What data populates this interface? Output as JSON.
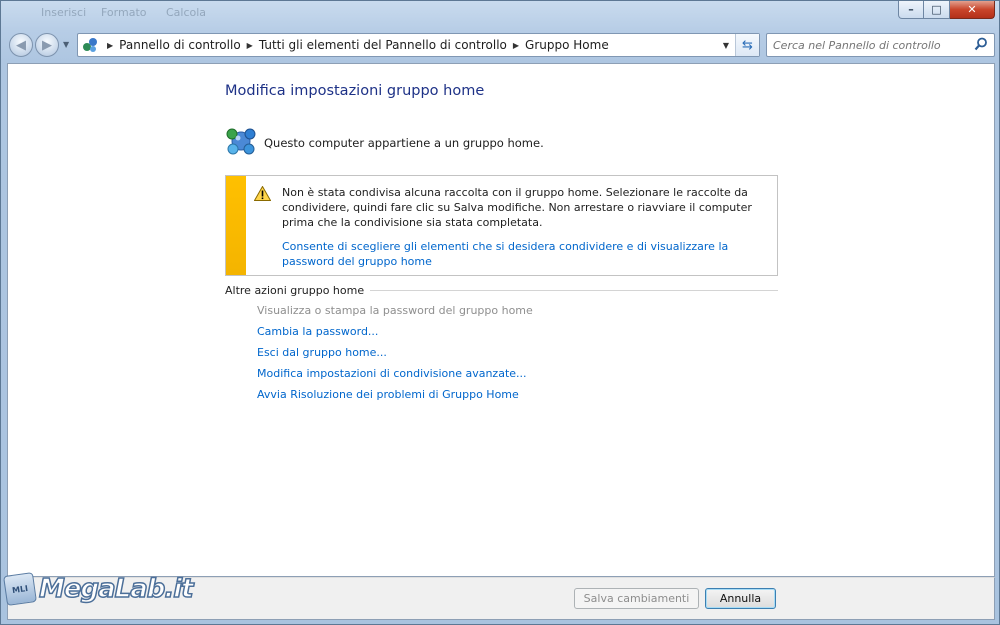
{
  "titlebar": {
    "ghost_items": [
      "Inserisci",
      "Formato",
      "Calcola"
    ],
    "minimize": "–",
    "maximize": "□",
    "close": "✕"
  },
  "address": {
    "crumbs": [
      "Pannello di controllo",
      "Tutti gli elementi del Pannello di controllo",
      "Gruppo Home"
    ]
  },
  "search": {
    "placeholder": "Cerca nel Pannello di controllo"
  },
  "page": {
    "title": "Modifica impostazioni gruppo home",
    "belongs_text": "Questo computer appartiene a un gruppo home.",
    "warning": {
      "text": "Non è stata condivisa alcuna raccolta con il gruppo home. Selezionare le raccolte da condividere, quindi fare clic su Salva modifiche. Non arrestare o riavviare il computer prima che la condivisione sia stata completata.",
      "link": "Consente di scegliere gli elementi che si desidera condividere e di visualizzare la password del gruppo home",
      "bar_color": "#ffc000"
    },
    "other_actions_header": "Altre azioni gruppo home",
    "other_actions": [
      {
        "label": "Visualizza o stampa la password del gruppo home",
        "enabled": false
      },
      {
        "label": "Cambia la password...",
        "enabled": true
      },
      {
        "label": "Esci dal gruppo home...",
        "enabled": true
      },
      {
        "label": "Modifica impostazioni di condivisione avanzate...",
        "enabled": true
      },
      {
        "label": "Avvia Risoluzione dei problemi di Gruppo Home",
        "enabled": true
      }
    ]
  },
  "footer": {
    "save_label": "Salva cambiamenti",
    "cancel_label": "Annulla"
  },
  "watermark": {
    "badge": "MLI",
    "text": "MegaLab.it"
  },
  "colors": {
    "link": "#0066cc",
    "title": "#1e3287",
    "disabled": "#8f8f8f"
  }
}
